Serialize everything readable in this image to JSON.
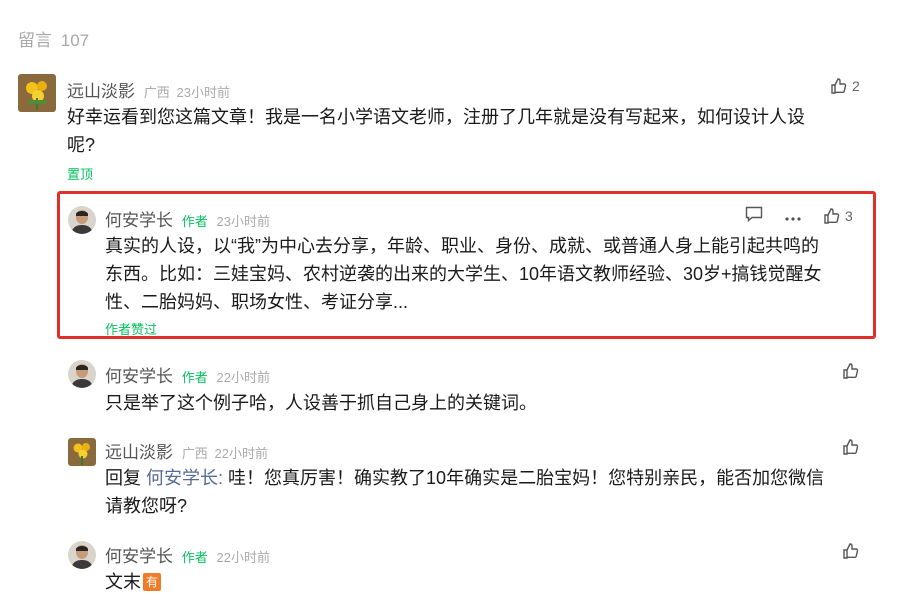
{
  "header": {
    "label": "留言",
    "count": "107"
  },
  "comments": [
    {
      "name": "远山淡影",
      "region": "广西",
      "time": "23小时前",
      "likes": "2",
      "text": "好幸运看到您这篇文章！我是一名小学语文老师，注册了几年就是没有写起来，如何设计人设呢?",
      "text_line1": "好幸运看到您这篇文章！我是一名小学语文老师，注册了几年就是没有写起来，如何设计人设",
      "text_line2": "呢?",
      "pinned_label": "置顶"
    }
  ],
  "replies": [
    {
      "name": "何安学长",
      "author_tag": "作者",
      "time": "23小时前",
      "likes": "3",
      "line1": "真实的人设，以“我”为中心去分享，年龄、职业、身份、成就、或普通人身上能引起共鸣的",
      "line2": "东西。比如：三娃宝妈、农村逆袭的出来的大学生、10年语文教师经验、30岁+搞钱觉醒女",
      "line3": "性、二胎妈妈、职场女性、考证分享...",
      "author_liked": "作者赞过"
    },
    {
      "name": "何安学长",
      "author_tag": "作者",
      "time": "22小时前",
      "text": "只是举了这个例子哈，人设善于抓自己身上的关键词。"
    },
    {
      "name": "远山淡影",
      "region": "广西",
      "time": "22小时前",
      "reply_prefix": "回复",
      "reply_to": "何安学长:",
      "line1": "哇！您真厉害！确实教了10年确实是二胎宝妈！您特别亲民，能否加您微信",
      "line2": "请教您呀?"
    },
    {
      "name": "何安学长",
      "author_tag": "作者",
      "time": "22小时前",
      "text": "文末",
      "badge": "有"
    }
  ]
}
